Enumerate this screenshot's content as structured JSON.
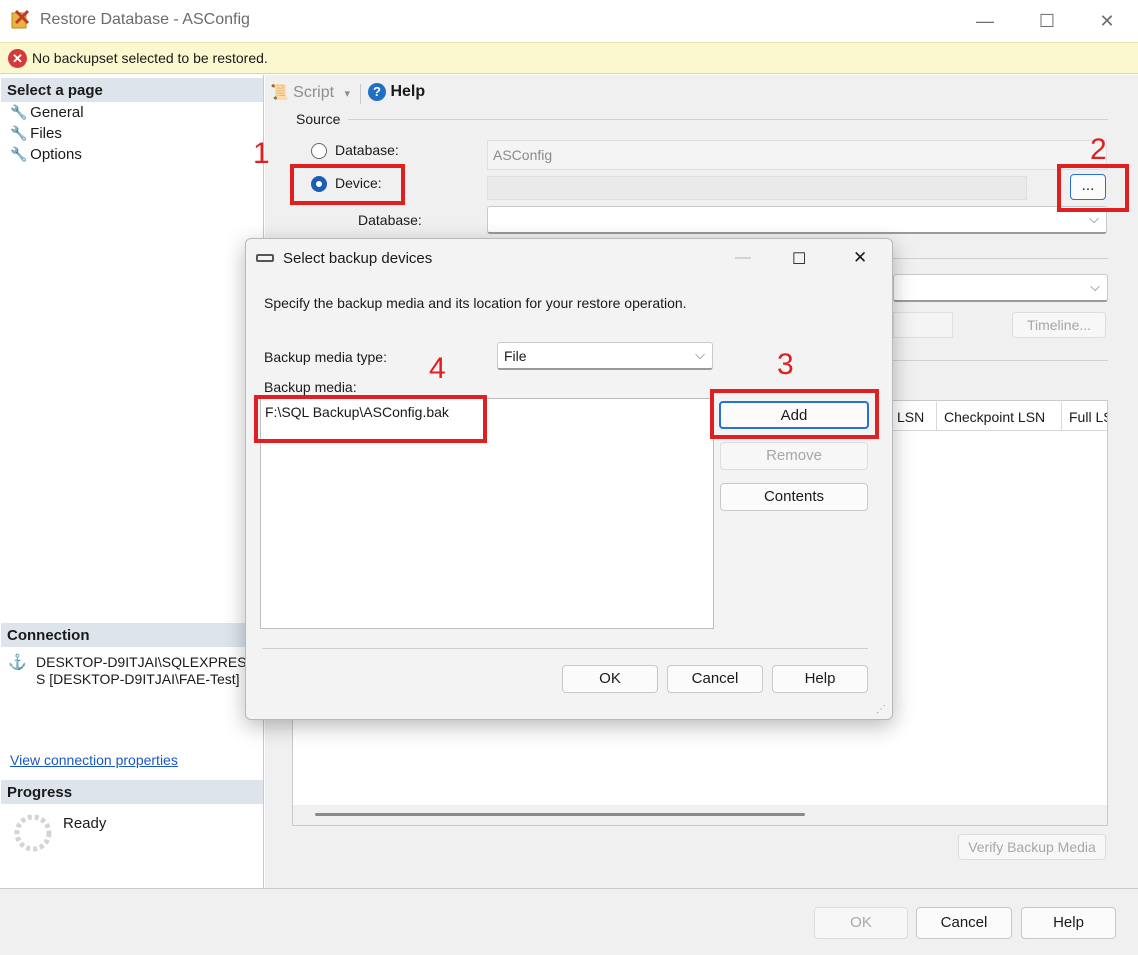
{
  "window": {
    "title": "Restore Database - ASConfig",
    "controls": {
      "minimize": "—",
      "maximize": "☐",
      "close": "✕"
    }
  },
  "error_bar": {
    "icon": "error-icon",
    "message": "No backupset selected to be restored."
  },
  "left_pane": {
    "select_page_header": "Select a page",
    "pages": [
      "General",
      "Files",
      "Options"
    ],
    "connection_header": "Connection",
    "connection_text_1": "DESKTOP-D9ITJAI\\SQLEXPRES",
    "connection_text_2": "S [DESKTOP-D9ITJAI\\FAE-Test]",
    "view_connection_link": "View connection properties",
    "progress_header": "Progress",
    "progress_status": "Ready"
  },
  "toolbar": {
    "script_label": "Script",
    "help_label": "Help"
  },
  "source": {
    "section_label": "Source",
    "database_label": "Database:",
    "database_value": "ASConfig",
    "device_label": "Device:",
    "device_value": "",
    "device_browse_label": "...",
    "dest_database_label": "Database:"
  },
  "right_background": {
    "timeline_label": "Timeline...",
    "grid_headers": [
      "LSN",
      "Checkpoint LSN",
      "Full LS"
    ],
    "verify_label": "Verify Backup Media"
  },
  "bottom_buttons": {
    "ok": "OK",
    "cancel": "Cancel",
    "help": "Help"
  },
  "dialog": {
    "title": "Select backup devices",
    "instruction": "Specify the backup media and its location for your restore operation.",
    "media_type_label": "Backup media type:",
    "media_type_value": "File",
    "media_label": "Backup media:",
    "media_items": [
      "F:\\SQL Backup\\ASConfig.bak"
    ],
    "add_label": "Add",
    "remove_label": "Remove",
    "contents_label": "Contents",
    "ok_label": "OK",
    "cancel_label": "Cancel",
    "help_label": "Help"
  },
  "annotations": {
    "n1": "1",
    "n2": "2",
    "n3": "3",
    "n4": "4",
    "color": "#e02020"
  }
}
